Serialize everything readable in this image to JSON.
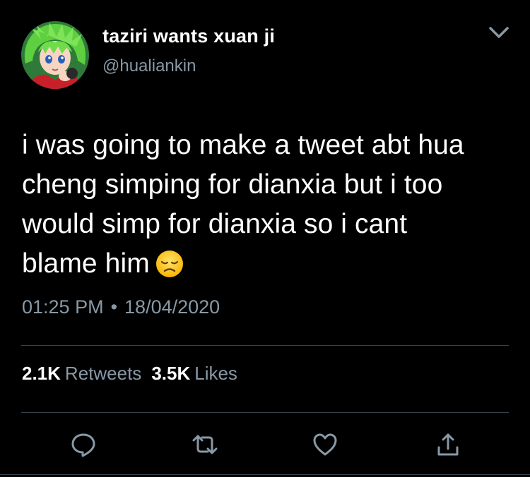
{
  "author": {
    "display_name": "taziri wants xuan ji",
    "handle": "@hualiankin",
    "avatar_icon": "anime-avatar"
  },
  "tweet": {
    "lines": [
      "i was going to make a tweet abt hua",
      "cheng simping for dianxia but i too",
      "would simp for dianxia so i cant",
      "blame him"
    ],
    "emoji": "disappointed-face-emoji",
    "time": "01:25 PM",
    "separator": "•",
    "date": "18/04/2020"
  },
  "stats": {
    "retweets_count": "2.1K",
    "retweets_label": "Retweets",
    "likes_count": "3.5K",
    "likes_label": "Likes"
  },
  "actions": {
    "reply_icon": "reply-icon",
    "retweet_icon": "retweet-icon",
    "like_icon": "heart-icon",
    "share_icon": "share-icon"
  },
  "colors": {
    "background": "#000000",
    "text": "#ffffff",
    "secondary_text": "#8899a6",
    "divider": "#38444d"
  }
}
